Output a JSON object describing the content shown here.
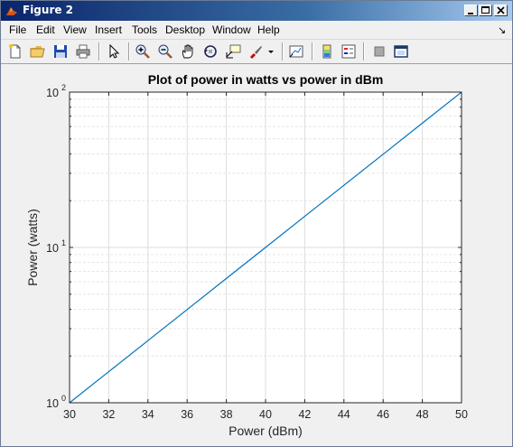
{
  "window": {
    "title": "Figure 2"
  },
  "menu": {
    "items": [
      "File",
      "Edit",
      "View",
      "Insert",
      "Tools",
      "Desktop",
      "Window",
      "Help"
    ],
    "overflow": "↘"
  },
  "toolbar": {
    "tools": [
      "new-figure-icon",
      "open-file-icon",
      "save-icon",
      "print-icon",
      "pointer-icon",
      "zoom-in-icon",
      "zoom-out-icon",
      "pan-icon",
      "rotate-3d-icon",
      "data-cursor-icon",
      "brush-icon",
      "link-plot-icon",
      "colorbar-icon",
      "legend-icon",
      "hide-plot-tools-icon",
      "show-plot-tools-icon"
    ]
  },
  "colors": {
    "line": "#0072bd",
    "title_bar_start": "#0a246a",
    "title_bar_end": "#a6caf0",
    "figure_bg": "#f0f0f0",
    "axes_bg": "#ffffff"
  },
  "chart_data": {
    "type": "line",
    "title": "Plot of power in watts vs power in dBm",
    "xlabel": "Power (dBm)",
    "ylabel": "Power (watts)",
    "xlim": [
      30,
      50
    ],
    "ylim": [
      1,
      100
    ],
    "yscale": "log",
    "grid": true,
    "minor_grid": true,
    "x_ticks": [
      "30",
      "32",
      "34",
      "36",
      "38",
      "40",
      "42",
      "44",
      "46",
      "48",
      "50"
    ],
    "y_ticks": [
      {
        "base": "10",
        "exp": "0"
      },
      {
        "base": "10",
        "exp": "1"
      },
      {
        "base": "10",
        "exp": "2"
      }
    ],
    "series": [
      {
        "x": [
          30,
          32,
          34,
          36,
          38,
          40,
          42,
          44,
          46,
          48,
          50
        ],
        "y": [
          1,
          1.585,
          2.512,
          3.981,
          6.31,
          10,
          15.85,
          25.12,
          39.81,
          63.1,
          100
        ]
      }
    ]
  }
}
